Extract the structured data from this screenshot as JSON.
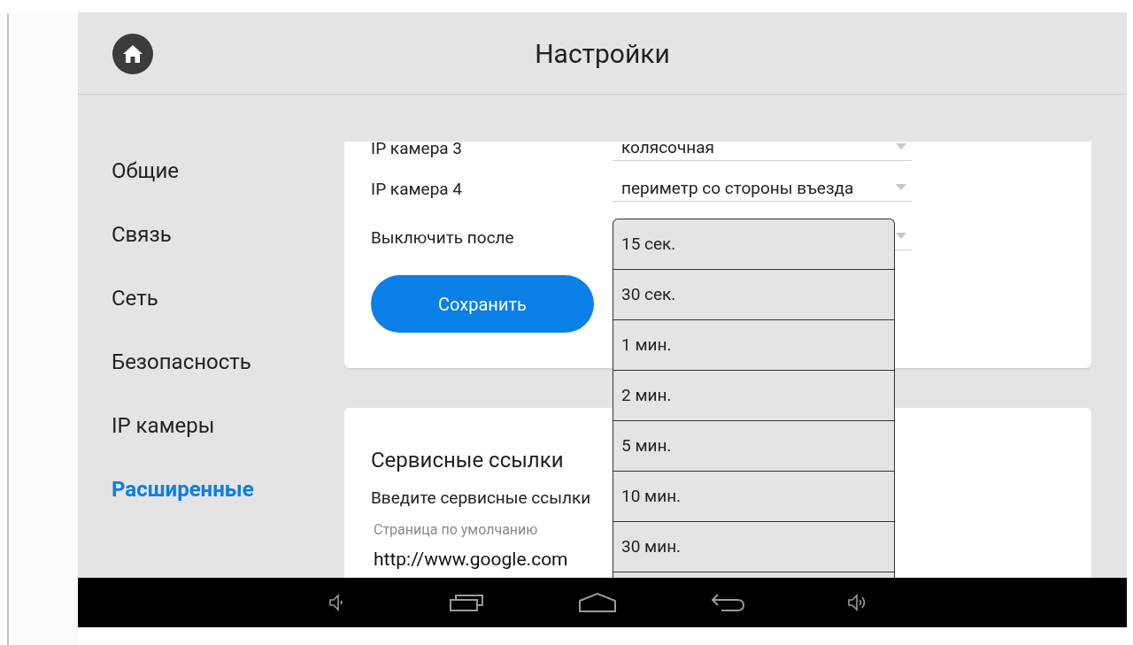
{
  "header": {
    "title": "Настройки"
  },
  "sidebar": {
    "items": [
      {
        "label": "Общие",
        "selected": false
      },
      {
        "label": "Связь",
        "selected": false
      },
      {
        "label": "Сеть",
        "selected": false
      },
      {
        "label": "Безопасность",
        "selected": false
      },
      {
        "label": "IP камеры",
        "selected": false
      },
      {
        "label": "Расширенные",
        "selected": true
      }
    ]
  },
  "camera_card": {
    "rows": [
      {
        "label": "IP камера 3",
        "value": "колясочная"
      },
      {
        "label": "IP камера 4",
        "value": "периметр со стороны въезда"
      },
      {
        "label": "Выключить после",
        "value": ""
      }
    ],
    "save_button": "Сохранить"
  },
  "dropdown": {
    "options": [
      "15 сек.",
      "30 сек.",
      "1 мин.",
      "2 мин.",
      "5 мин.",
      "10 мин.",
      "30 мин."
    ]
  },
  "service_card": {
    "title": "Сервисные ссылки",
    "hint": "Введите сервисные ссылки",
    "field": {
      "label": "Страница по умолчанию",
      "value": "http://www.google.com"
    }
  }
}
